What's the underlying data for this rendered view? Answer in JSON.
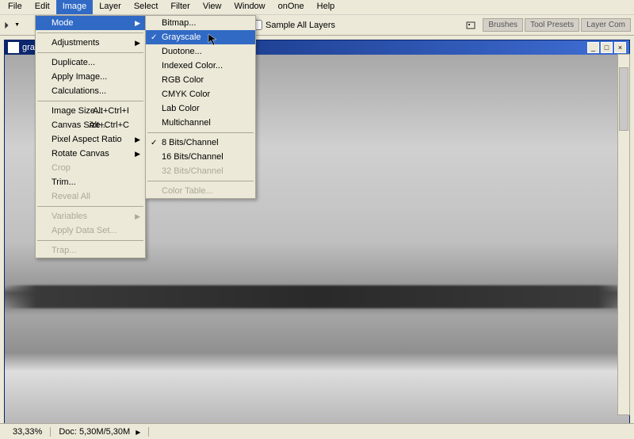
{
  "menubar": {
    "items": [
      "File",
      "Edit",
      "Image",
      "Layer",
      "Select",
      "Filter",
      "View",
      "Window",
      "onOne",
      "Help"
    ]
  },
  "toolbar": {
    "sample_all_layers": "Sample All Layers",
    "tabs": [
      "Brushes",
      "Tool Presets",
      "Layer Com"
    ]
  },
  "doc": {
    "title": "grays"
  },
  "image_menu": {
    "mode": "Mode",
    "adjustments": "Adjustments",
    "duplicate": "Duplicate...",
    "apply_image": "Apply Image...",
    "calculations": "Calculations...",
    "image_size": "Image Size...",
    "image_size_key": "Alt+Ctrl+I",
    "canvas_size": "Canvas Size...",
    "canvas_size_key": "Alt+Ctrl+C",
    "pixel_aspect": "Pixel Aspect Ratio",
    "rotate_canvas": "Rotate Canvas",
    "crop": "Crop",
    "trim": "Trim...",
    "reveal_all": "Reveal All",
    "variables": "Variables",
    "apply_data_set": "Apply Data Set...",
    "trap": "Trap..."
  },
  "mode_menu": {
    "bitmap": "Bitmap...",
    "grayscale": "Grayscale",
    "duotone": "Duotone...",
    "indexed": "Indexed Color...",
    "rgb": "RGB Color",
    "cmyk": "CMYK Color",
    "lab": "Lab Color",
    "multichannel": "Multichannel",
    "bits8": "8 Bits/Channel",
    "bits16": "16 Bits/Channel",
    "bits32": "32 Bits/Channel",
    "color_table": "Color Table..."
  },
  "status": {
    "zoom": "33,33%",
    "doc_size_label": "Doc:",
    "doc_size": "5,30M/5,30M"
  }
}
